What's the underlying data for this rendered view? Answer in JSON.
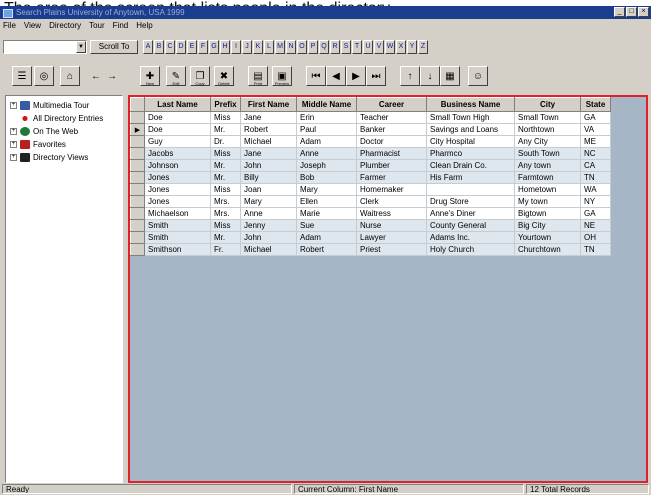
{
  "caption": "The area of the screen that lists people in the directory.",
  "window": {
    "title": "Search Plains University of Anytown, USA 1999",
    "controls": [
      "_",
      "□",
      "×"
    ]
  },
  "menu": [
    "File",
    "View",
    "Directory",
    "Tour",
    "Find",
    "Help"
  ],
  "search": {
    "value": "",
    "scroll_to_label": "Scroll To"
  },
  "letters": [
    "A",
    "B",
    "C",
    "D",
    "E",
    "F",
    "G",
    "H",
    "I",
    "J",
    "K",
    "L",
    "M",
    "N",
    "O",
    "P",
    "Q",
    "R",
    "S",
    "T",
    "U",
    "V",
    "W",
    "X",
    "Y",
    "Z"
  ],
  "toolbar": {
    "buttons": [
      {
        "icon": "directory-icon",
        "caption": ""
      },
      {
        "icon": "web-icon",
        "caption": ""
      },
      {
        "icon": "home-icon",
        "caption": ""
      },
      {
        "icon": "back-arrow-icon",
        "caption": ""
      },
      {
        "icon": "forward-arrow-icon",
        "caption": ""
      },
      {
        "icon": "new-entry-icon",
        "caption": "New"
      },
      {
        "icon": "edit-entry-icon",
        "caption": "Edit"
      },
      {
        "icon": "copy-entry-icon",
        "caption": "Copy"
      },
      {
        "icon": "delete-entry-icon",
        "caption": "Delete"
      },
      {
        "icon": "print-icon",
        "caption": "Print"
      },
      {
        "icon": "print-preview-icon",
        "caption": "Preview"
      },
      {
        "icon": "first-record-icon",
        "caption": ""
      },
      {
        "icon": "previous-record-icon",
        "caption": ""
      },
      {
        "icon": "next-record-icon",
        "caption": ""
      },
      {
        "icon": "last-record-icon",
        "caption": ""
      },
      {
        "icon": "sort-ascending-icon",
        "caption": ""
      },
      {
        "icon": "sort-descending-icon",
        "caption": ""
      },
      {
        "icon": "filter-icon",
        "caption": ""
      },
      {
        "icon": "person-icon",
        "caption": ""
      }
    ]
  },
  "tree": [
    {
      "label": "Multimedia Tour",
      "icon": "multimedia-icon",
      "expander": "+"
    },
    {
      "label": "All Directory Entries",
      "icon": "bullet-icon",
      "expander": ""
    },
    {
      "label": "On The Web",
      "icon": "globe-icon",
      "expander": "+"
    },
    {
      "label": "Favorites",
      "icon": "heart-icon",
      "expander": "+"
    },
    {
      "label": "Directory Views",
      "icon": "binoculars-icon",
      "expander": "+"
    }
  ],
  "grid": {
    "columns": [
      "Last Name",
      "Prefix",
      "First Name",
      "Middle Name",
      "Career",
      "Business Name",
      "City",
      "State"
    ],
    "rows": [
      [
        "Doe",
        "Miss",
        "Jane",
        "Erin",
        "Teacher",
        "Small Town High",
        "Small Town",
        "GA"
      ],
      [
        "Doe",
        "Mr.",
        "Robert",
        "Paul",
        "Banker",
        "Savings and Loans",
        "Northtown",
        "VA"
      ],
      [
        "Guy",
        "Dr.",
        "Michael",
        "Adam",
        "Doctor",
        "City Hospital",
        "Any City",
        "ME"
      ],
      [
        "Jacobs",
        "Miss",
        "Jane",
        "Anne",
        "Pharmacist",
        "Pharmco",
        "South Town",
        "NC"
      ],
      [
        "Johnson",
        "Mr.",
        "John",
        "Joseph",
        "Plumber",
        "Clean Drain Co.",
        "Any town",
        "CA"
      ],
      [
        "Jones",
        "Mr.",
        "Billy",
        "Bob",
        "Farmer",
        "His Farm",
        "Farmtown",
        "TN"
      ],
      [
        "Jones",
        "Miss",
        "Joan",
        "Mary",
        "Homemaker",
        "",
        "Hometown",
        "WA"
      ],
      [
        "Jones",
        "Mrs.",
        "Mary",
        "Ellen",
        "Clerk",
        "Drug Store",
        "My town",
        "NY"
      ],
      [
        "Michaelson",
        "Mrs.",
        "Anne",
        "Marie",
        "Waitress",
        "Anne's Diner",
        "Bigtown",
        "GA"
      ],
      [
        "Smith",
        "Miss",
        "Jenny",
        "Sue",
        "Nurse",
        "County General",
        "Big City",
        "NE"
      ],
      [
        "Smith",
        "Mr.",
        "John",
        "Adam",
        "Lawyer",
        "Adams Inc.",
        "Yourtown",
        "OH"
      ],
      [
        "Smithson",
        "Fr.",
        "Michael",
        "Robert",
        "Priest",
        "Holy Church",
        "Churchtown",
        "TN"
      ]
    ],
    "current_row_index": 1,
    "current_marker": "▶"
  },
  "status": {
    "left": "Ready",
    "middle": "Current Column: First Name",
    "right": "12 Total Records"
  },
  "colors": {
    "title_bar": "#1a3d8f",
    "highlight_border": "#e2202a",
    "grid_background": "#a6b6c6",
    "chrome": "#d4d0c8"
  }
}
